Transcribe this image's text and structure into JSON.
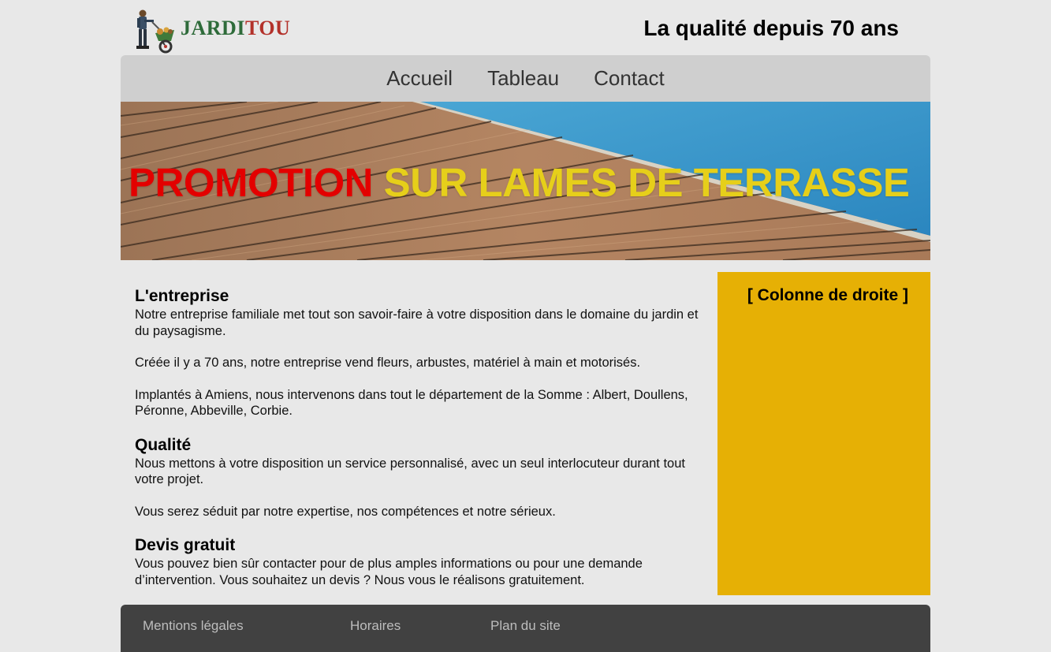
{
  "header": {
    "logo": {
      "part1": "JARDI",
      "part2": "TOU"
    },
    "tagline": "La qualité depuis 70 ans"
  },
  "nav": {
    "items": [
      {
        "label": "Accueil"
      },
      {
        "label": "Tableau"
      },
      {
        "label": "Contact"
      }
    ]
  },
  "banner": {
    "title_red": "PROMOTION",
    "title_yellow": "SUR LAMES DE TERRASSE"
  },
  "main": {
    "sections": [
      {
        "heading": "L'entreprise",
        "paragraphs": [
          "Notre entreprise familiale met tout son savoir-faire à votre disposition dans le domaine du jardin et du paysagisme.",
          "Créée il y a 70 ans, notre entreprise vend fleurs, arbustes, matériel à main et motorisés.",
          "Implantés à Amiens, nous intervenons dans tout le département de la Somme : Albert, Doullens, Péronne, Abbeville, Corbie."
        ]
      },
      {
        "heading": "Qualité",
        "paragraphs": [
          "Nous mettons à votre disposition un service personnalisé, avec un seul interlocuteur durant tout votre projet.",
          "Vous serez séduit par notre expertise, nos compétences et notre sérieux."
        ]
      },
      {
        "heading": "Devis gratuit",
        "paragraphs": [
          "Vous pouvez bien sûr contacter pour de plus amples informations ou pour une demande d’intervention. Vous souhaitez un devis ? Nous vous le réalisons gratuitement."
        ]
      }
    ]
  },
  "aside": {
    "title": "[ Colonne de droite ]"
  },
  "footer": {
    "links": [
      {
        "label": "Mentions légales"
      },
      {
        "label": "Horaires"
      },
      {
        "label": "Plan du site"
      }
    ]
  },
  "colors": {
    "background": "#e8e8e8",
    "nav": "#cfcfcf",
    "aside": "#e6b005",
    "footer": "#414141",
    "promo_red": "#e30000",
    "promo_yellow": "#e6cf1a",
    "logo_green": "#2e6b3a",
    "logo_red": "#b3312a"
  },
  "icons": {
    "logo": "gardener-wheelbarrow-icon"
  }
}
